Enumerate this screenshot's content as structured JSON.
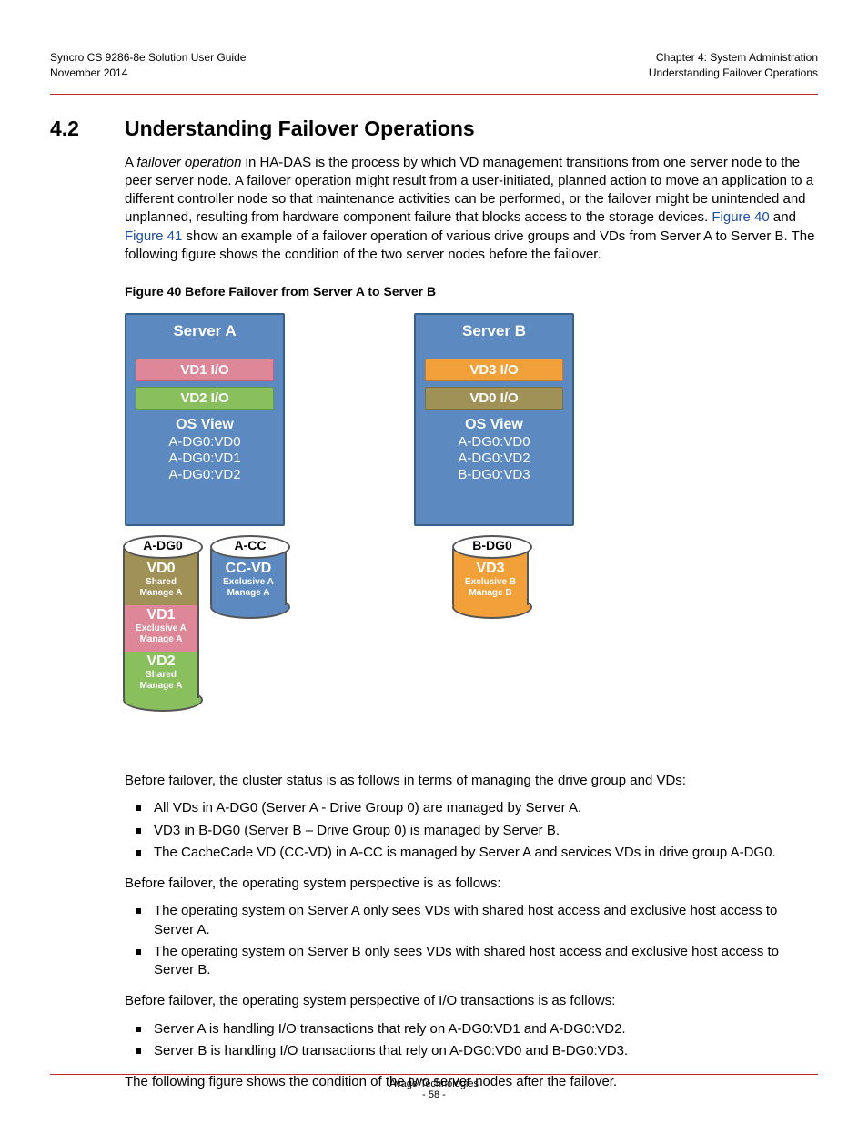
{
  "header": {
    "left_line1": "Syncro CS 9286-8e Solution User Guide",
    "left_line2": "November 2014",
    "right_line1": "Chapter 4: System Administration",
    "right_line2": "Understanding Failover Operations"
  },
  "section": {
    "num": "4.2",
    "title": "Understanding Failover Operations"
  },
  "intro": {
    "p1_pre": "A ",
    "p1_term": "failover operation",
    "p1_mid": " in HA-DAS is the process by which VD management transitions from one server node to the peer server node. A failover operation might result from a user-initiated, planned action to move an application to a different controller node so that maintenance activities can be performed, or the failover might be unintended and unplanned, resulting from hardware component failure that blocks access to the storage devices. ",
    "fig40_link": "Figure 40",
    "p1_and": " and ",
    "fig41_link": "Figure 41",
    "p1_post": " show an example of a failover operation of various drive groups and VDs from Server A to Server B. The following figure shows the condition of the two server nodes before the failover."
  },
  "fig40_caption": "Figure 40  Before Failover from Server A to Server B",
  "diagram": {
    "serverA": {
      "title": "Server A",
      "bar1": "VD1 I/O",
      "bar2": "VD2 I/O",
      "os_title": "OS View",
      "os1": "A-DG0:VD0",
      "os2": "A-DG0:VD1",
      "os3": "A-DG0:VD2"
    },
    "serverB": {
      "title": "Server B",
      "bar1": "VD3 I/O",
      "bar2": "VD0 I/O",
      "os_title": "OS View",
      "os1": "A-DG0:VD0",
      "os2": "A-DG0:VD2",
      "os3": "B-DG0:VD3"
    },
    "cyl_adg0": {
      "label": "A-DG0",
      "vd0": "VD0",
      "vd0_s1": "Shared",
      "vd0_s2": "Manage A",
      "vd1": "VD1",
      "vd1_s1": "Exclusive A",
      "vd1_s2": "Manage A",
      "vd2": "VD2",
      "vd2_s1": "Shared",
      "vd2_s2": "Manage A"
    },
    "cyl_acc": {
      "label": "A-CC",
      "vd": "CC-VD",
      "s1": "Exclusive A",
      "s2": "Manage A"
    },
    "cyl_bdg0": {
      "label": "B-DG0",
      "vd": "VD3",
      "s1": "Exclusive B",
      "s2": "Manage B"
    }
  },
  "after": {
    "p2": "Before failover, the cluster status is as follows in terms of managing the drive group and VDs:",
    "b1": "All VDs in A-DG0 (Server A - Drive Group 0) are managed by Server A.",
    "b2": "VD3 in B-DG0 (Server B – Drive Group 0) is managed by Server B.",
    "b3": "The CacheCade VD (CC-VD) in A-CC is managed by Server A and services VDs in drive group A-DG0.",
    "p3": "Before failover, the operating system perspective is as follows:",
    "c1": "The operating system on Server A only sees VDs with shared host access and exclusive host access to Server A.",
    "c2": "The operating system on Server B only sees VDs with shared host access and exclusive host access to Server B.",
    "p4": "Before failover, the operating system perspective of I/O transactions is as follows:",
    "d1": "Server A is handling I/O transactions that rely on A-DG0:VD1 and A-DG0:VD2.",
    "d2": "Server B is handling I/O transactions that rely on A-DG0:VD0 and B-DG0:VD3.",
    "p5": "The following figure shows the condition of the two server nodes after the failover."
  },
  "footer": {
    "company": "Avago Technologies",
    "page": "- 58 -"
  }
}
